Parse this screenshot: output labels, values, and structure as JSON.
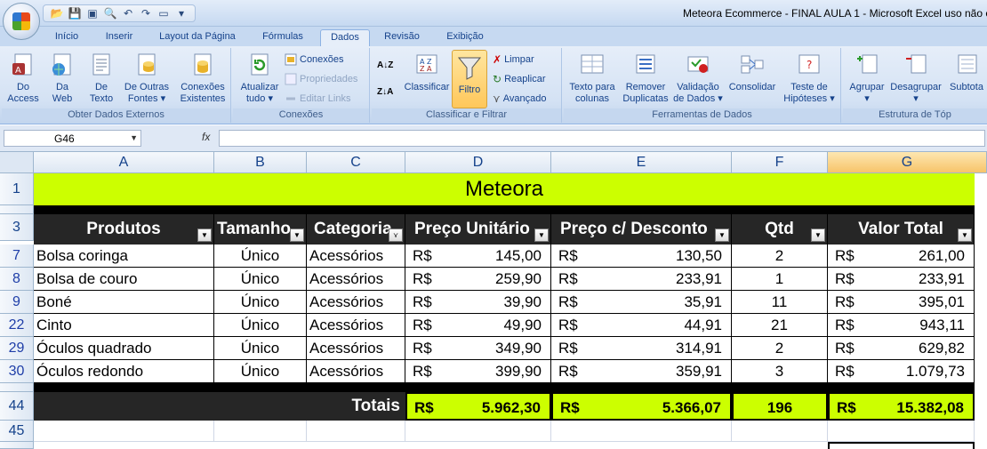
{
  "window": {
    "title": "Meteora Ecommerce - FINAL AULA 1 - Microsoft Excel uso não c"
  },
  "qat_icons": [
    "folder-open-icon",
    "save-icon",
    "save-as-icon",
    "print-preview-icon",
    "undo-icon",
    "redo-icon",
    "folder-icon",
    "customize-icon"
  ],
  "tabs": [
    {
      "label": "Início"
    },
    {
      "label": "Inserir"
    },
    {
      "label": "Layout da Página"
    },
    {
      "label": "Fórmulas"
    },
    {
      "label": "Dados"
    },
    {
      "label": "Revisão"
    },
    {
      "label": "Exibição"
    }
  ],
  "ribbon": {
    "groups": [
      {
        "label": "Obter Dados Externos"
      },
      {
        "label": "Conexões"
      },
      {
        "label": "Classificar e Filtrar"
      },
      {
        "label": "Ferramentas de Dados"
      },
      {
        "label": "Estrutura de Tóp"
      }
    ],
    "buttons": {
      "access": "Do\nAccess",
      "web": "Da\nWeb",
      "texto": "De\nTexto",
      "outras": "De Outras\nFontes ▾",
      "existentes": "Conexões\nExistentes",
      "atualizar": "Atualizar\ntudo ▾",
      "conexoes": "Conexões",
      "propriedades": "Propriedades",
      "editar_links": "Editar Links",
      "classificar": "Classificar",
      "filtro": "Filtro",
      "limpar": "Limpar",
      "reaplicar": "Reaplicar",
      "avancado": "Avançado",
      "texto_colunas": "Texto para\ncolunas",
      "remover": "Remover\nDuplicatas",
      "validacao": "Validação\nde Dados ▾",
      "consolidar": "Consolidar",
      "teste": "Teste de\nHipóteses ▾",
      "agrupar": "Agrupar\n▾",
      "desagrupar": "Desagrupar\n▾",
      "subtotal": "Subtota"
    }
  },
  "formula_bar": {
    "name_box": "G46",
    "fx": "fx",
    "formula": ""
  },
  "columns": [
    "A",
    "B",
    "C",
    "D",
    "E",
    "F",
    "G"
  ],
  "rows": [
    "1",
    "3",
    "7",
    "8",
    "9",
    "22",
    "29",
    "30",
    "44",
    "45"
  ],
  "sheet": {
    "title": "Meteora",
    "headers": [
      "Produtos",
      "Tamanho",
      "Categoria",
      "Preço Unitário",
      "Preço c/ Desconto",
      "Qtd",
      "Valor Total"
    ],
    "currency": "R$",
    "records": [
      {
        "produto": "Bolsa coringa",
        "tamanho": "Único",
        "categoria": "Acessórios",
        "preco": "145,00",
        "desconto": "130,50",
        "qtd": "2",
        "total": "261,00"
      },
      {
        "produto": "Bolsa de couro",
        "tamanho": "Único",
        "categoria": "Acessórios",
        "preco": "259,90",
        "desconto": "233,91",
        "qtd": "1",
        "total": "233,91"
      },
      {
        "produto": "Boné",
        "tamanho": "Único",
        "categoria": "Acessórios",
        "preco": "39,90",
        "desconto": "35,91",
        "qtd": "11",
        "total": "395,01"
      },
      {
        "produto": "Cinto",
        "tamanho": "Único",
        "categoria": "Acessórios",
        "preco": "49,90",
        "desconto": "44,91",
        "qtd": "21",
        "total": "943,11"
      },
      {
        "produto": "Óculos quadrado",
        "tamanho": "Único",
        "categoria": "Acessórios",
        "preco": "349,90",
        "desconto": "314,91",
        "qtd": "2",
        "total": "629,82"
      },
      {
        "produto": "Óculos redondo",
        "tamanho": "Único",
        "categoria": "Acessórios",
        "preco": "399,90",
        "desconto": "359,91",
        "qtd": "3",
        "total": "1.079,73"
      }
    ],
    "totals": {
      "label": "Totais",
      "preco": "5.962,30",
      "desconto": "5.366,07",
      "qtd": "196",
      "total": "15.382,08"
    }
  },
  "colors": {
    "title_fill": "#ccff00",
    "header_fill": "#262626",
    "selected_col": "#f7c469"
  }
}
